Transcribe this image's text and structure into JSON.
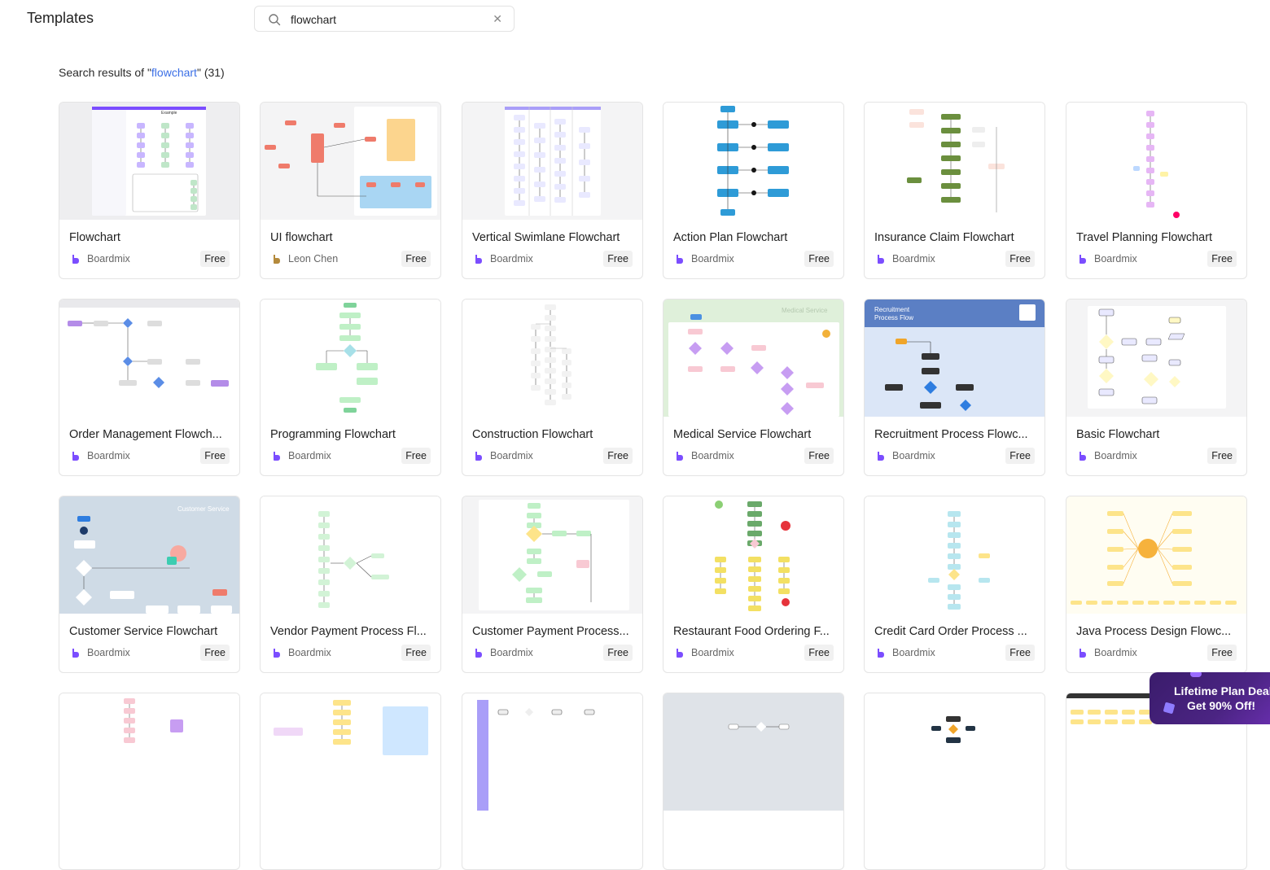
{
  "header": {
    "title": "Templates",
    "search": {
      "value": "flowchart",
      "placeholder": ""
    }
  },
  "results": {
    "prefix": "Search results of \"",
    "query": "flowchart",
    "suffix": "\" (31)"
  },
  "templates": [
    {
      "title": "Flowchart",
      "author": "Boardmix",
      "badge": "Free"
    },
    {
      "title": "UI flowchart",
      "author": "Leon Chen",
      "badge": "Free"
    },
    {
      "title": "Vertical Swimlane Flowchart",
      "author": "Boardmix",
      "badge": "Free"
    },
    {
      "title": "Action Plan Flowchart",
      "author": "Boardmix",
      "badge": "Free"
    },
    {
      "title": "Insurance Claim Flowchart",
      "author": "Boardmix",
      "badge": "Free"
    },
    {
      "title": "Travel Planning Flowchart",
      "author": "Boardmix",
      "badge": "Free"
    },
    {
      "title": "Order Management Flowch...",
      "author": "Boardmix",
      "badge": "Free"
    },
    {
      "title": "Programming Flowchart",
      "author": "Boardmix",
      "badge": "Free"
    },
    {
      "title": "Construction Flowchart",
      "author": "Boardmix",
      "badge": "Free"
    },
    {
      "title": "Medical Service Flowchart",
      "author": "Boardmix",
      "badge": "Free"
    },
    {
      "title": "Recruitment Process Flowc...",
      "author": "Boardmix",
      "badge": "Free"
    },
    {
      "title": "Basic Flowchart",
      "author": "Boardmix",
      "badge": "Free"
    },
    {
      "title": "Customer Service Flowchart",
      "author": "Boardmix",
      "badge": "Free"
    },
    {
      "title": "Vendor Payment Process Fl...",
      "author": "Boardmix",
      "badge": "Free"
    },
    {
      "title": "Customer Payment Process...",
      "author": "Boardmix",
      "badge": "Free"
    },
    {
      "title": "Restaurant Food Ordering F...",
      "author": "Boardmix",
      "badge": "Free"
    },
    {
      "title": "Credit Card Order Process ...",
      "author": "Boardmix",
      "badge": "Free"
    },
    {
      "title": "Java Process Design Flowc...",
      "author": "Boardmix",
      "badge": "Free"
    },
    {
      "title": "",
      "author": "",
      "badge": ""
    },
    {
      "title": "",
      "author": "",
      "badge": ""
    },
    {
      "title": "",
      "author": "",
      "badge": ""
    },
    {
      "title": "",
      "author": "",
      "badge": ""
    },
    {
      "title": "",
      "author": "",
      "badge": ""
    },
    {
      "title": "",
      "author": "",
      "badge": ""
    }
  ],
  "thumbnails": {
    "Medical Service Flowchart": "Medical Service",
    "Recruitment Process Flowc...": "Recruitment\nProcess Flow",
    "Customer Service Flowchart": "Customer Service"
  },
  "thumb_text": {
    "medical": "Medical Service",
    "recruit_1": "Recruitment",
    "recruit_2": "Process Flow",
    "customer": "Customer Service",
    "example": "Example"
  },
  "promo": {
    "line1": "Lifetime Plan Deal",
    "line2": "Get 90% Off!"
  },
  "colors": {
    "accent": "#3b6fe6",
    "boardmix_logo": "#7b4dff",
    "promo_bg": "#4b2483"
  }
}
